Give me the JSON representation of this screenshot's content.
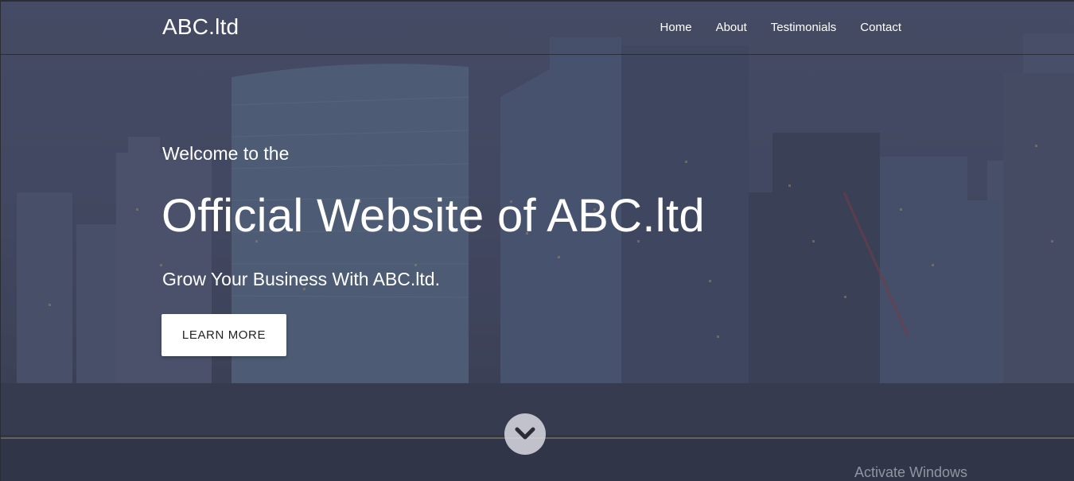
{
  "navbar": {
    "brand": "ABC.ltd",
    "links": [
      "Home",
      "About",
      "Testimonials",
      "Contact"
    ]
  },
  "hero": {
    "welcome": "Welcome to the",
    "headline": "Official Website of ABC.ltd",
    "tagline": "Grow Your Business With ABC.ltd.",
    "cta_label": "LEARN MORE",
    "scroll_icon": "chevron-down-icon"
  },
  "system": {
    "watermark": "Activate Windows"
  },
  "colors": {
    "overlay": "#4a5069",
    "text": "#ffffff",
    "button_bg": "#ffffff",
    "button_text": "#222222"
  }
}
